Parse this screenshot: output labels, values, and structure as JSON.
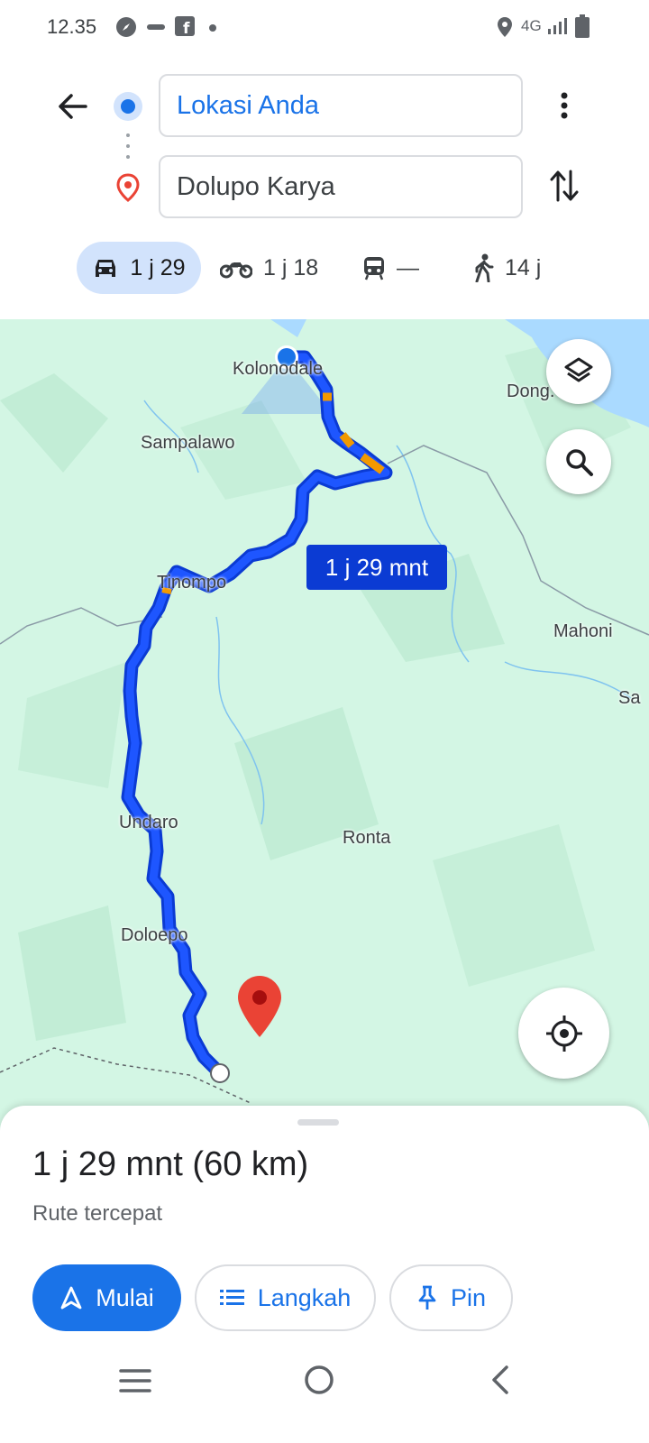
{
  "status_bar": {
    "time": "12.35",
    "network": "4G"
  },
  "header": {
    "origin": "Lokasi Anda",
    "destination": "Dolupo Karya"
  },
  "modes": [
    {
      "icon": "car-icon",
      "label": "1 j 29",
      "selected": true
    },
    {
      "icon": "motorcycle-icon",
      "label": "1 j 18",
      "selected": false
    },
    {
      "icon": "transit-icon",
      "label": "—",
      "selected": false
    },
    {
      "icon": "walk-icon",
      "label": "14 j",
      "selected": false
    }
  ],
  "map": {
    "places": [
      "Kolonodale",
      "Dong.",
      "Sampalawo",
      "Tinompo",
      "Mahoni",
      "Sa",
      "Undaro",
      "Ronta",
      "Doloepo"
    ],
    "route_eta": "1 j 29 mnt"
  },
  "sheet": {
    "duration": "1 j 29 mnt (60 km)",
    "subtitle": "Rute tercepat",
    "start_label": "Mulai",
    "steps_label": "Langkah",
    "pin_label": "Pin"
  },
  "colors": {
    "accent": "#1a73e8",
    "route": "#0b3bd3",
    "map_bg": "#d3f6e4",
    "pin": "#ea4335"
  }
}
